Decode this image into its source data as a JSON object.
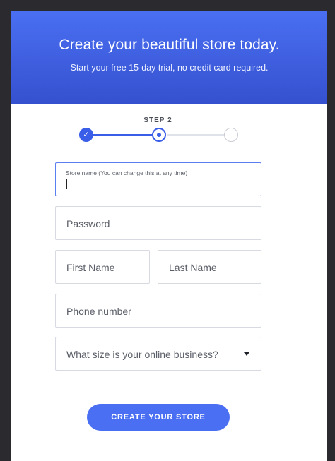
{
  "hero": {
    "title": "Create your beautiful store today.",
    "subtitle": "Start your free 15-day trial, no credit card required."
  },
  "stepper": {
    "label": "STEP 2",
    "steps": [
      {
        "state": "completed",
        "icon": "check-icon"
      },
      {
        "state": "current"
      },
      {
        "state": "upcoming"
      }
    ]
  },
  "form": {
    "store_name_label": "Store name (You can change this at any time)",
    "store_name_value": "",
    "password_placeholder": "Password",
    "first_name_placeholder": "First Name",
    "last_name_placeholder": "Last Name",
    "phone_placeholder": "Phone number",
    "business_size_placeholder": "What size is your online business?"
  },
  "cta": {
    "label": "CREATE YOUR STORE"
  },
  "colors": {
    "accent": "#3a5ee8",
    "hero_top": "#4a6ff2",
    "hero_bottom": "#3551cf",
    "background": "#2b2b2f"
  }
}
